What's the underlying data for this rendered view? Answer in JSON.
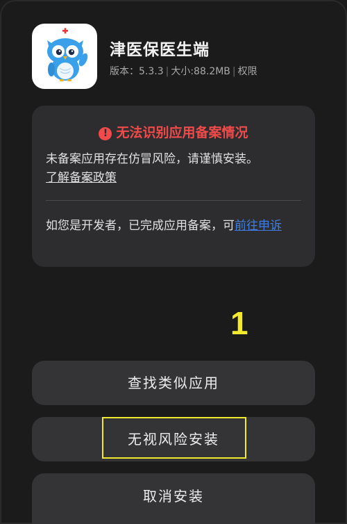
{
  "app": {
    "name": "津医保医生端",
    "version_label": "版本：5.3.3",
    "size_label": "大小:88.2MB",
    "permissions_label": "权限",
    "icon": "owl-app-icon"
  },
  "warning": {
    "icon": "exclamation-circle-icon",
    "title": "无法识别应用备案情况",
    "body": "未备案应用存在仿冒风险，请谨慎安装。",
    "policy_link": "了解备案政策",
    "developer_text": "如您是开发者，已完成应用备案，可",
    "appeal_link": "前往申诉"
  },
  "annotation": {
    "step_number": "1"
  },
  "buttons": {
    "find_similar": "查找类似应用",
    "ignore_risk_install": "无视风险安装",
    "cancel_install": "取消安装"
  },
  "colors": {
    "background": "#1b1b1c",
    "card": "#2d2d2f",
    "button": "#343436",
    "warning_red": "#f04a4a",
    "link_blue": "#3f7ee0",
    "highlight_yellow": "#f2ea2c"
  }
}
